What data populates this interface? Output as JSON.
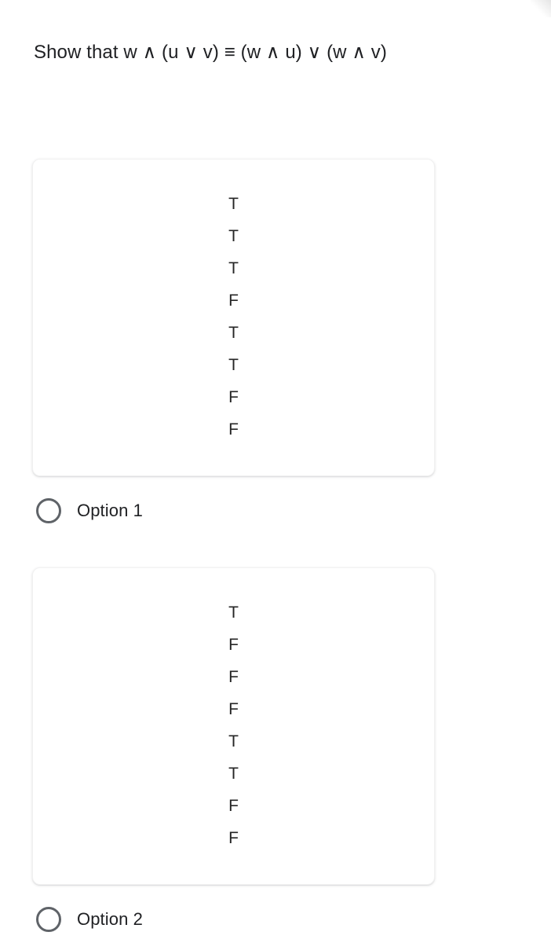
{
  "question": {
    "text": "Show that w ∧ (u ∨ v) ≡ (w ∧ u) ∨ (w ∧ v)"
  },
  "colors": {
    "page_background": "#ffffff",
    "text": "#202124",
    "truth_value_text": "#262626",
    "card_border": "#f1f1f1",
    "radio_stroke": "#5f6368"
  },
  "answers": [
    {
      "id": "option-1",
      "label": "Option 1",
      "selected": false,
      "truth_values": [
        "T",
        "T",
        "T",
        "F",
        "T",
        "T",
        "F",
        "F"
      ]
    },
    {
      "id": "option-2",
      "label": "Option 2",
      "selected": false,
      "truth_values": [
        "T",
        "F",
        "F",
        "F",
        "T",
        "T",
        "F",
        "F"
      ]
    }
  ]
}
